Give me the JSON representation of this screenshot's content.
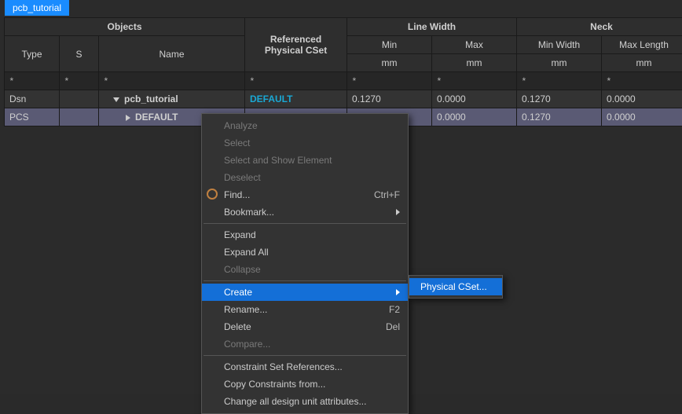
{
  "tab": {
    "label": "pcb_tutorial"
  },
  "headers": {
    "objects": "Objects",
    "type": "Type",
    "s": "S",
    "name": "Name",
    "refcset": "Referenced Physical CSet",
    "linewidth": "Line Width",
    "lw_min": "Min",
    "lw_max": "Max",
    "neck": "Neck",
    "nk_minw": "Min Width",
    "nk_maxl": "Max Length",
    "unit_mm": "mm"
  },
  "filter": {
    "star": "*"
  },
  "rows": {
    "dsn": {
      "type": "Dsn",
      "s": "",
      "name": "pcb_tutorial",
      "cset": "DEFAULT",
      "lw_min": "0.1270",
      "lw_max": "0.0000",
      "nk_minw": "0.1270",
      "nk_maxl": "0.0000"
    },
    "pcs": {
      "type": "PCS",
      "s": "",
      "name": "DEFAULT",
      "cset": "",
      "lw_min": "",
      "lw_max": "0.0000",
      "nk_minw": "0.1270",
      "nk_maxl": "0.0000"
    }
  },
  "menu": {
    "analyze": "Analyze",
    "select": "Select",
    "select_show": "Select and Show Element",
    "deselect": "Deselect",
    "find": "Find...",
    "find_sc": "Ctrl+F",
    "bookmark": "Bookmark...",
    "expand": "Expand",
    "expand_all": "Expand All",
    "collapse": "Collapse",
    "create": "Create",
    "rename": "Rename...",
    "rename_sc": "F2",
    "delete": "Delete",
    "delete_sc": "Del",
    "compare": "Compare...",
    "csr": "Constraint Set References...",
    "ccf": "Copy Constraints from...",
    "cadua": "Change all design unit attributes..."
  },
  "submenu": {
    "physical_cset": "Physical CSet..."
  }
}
